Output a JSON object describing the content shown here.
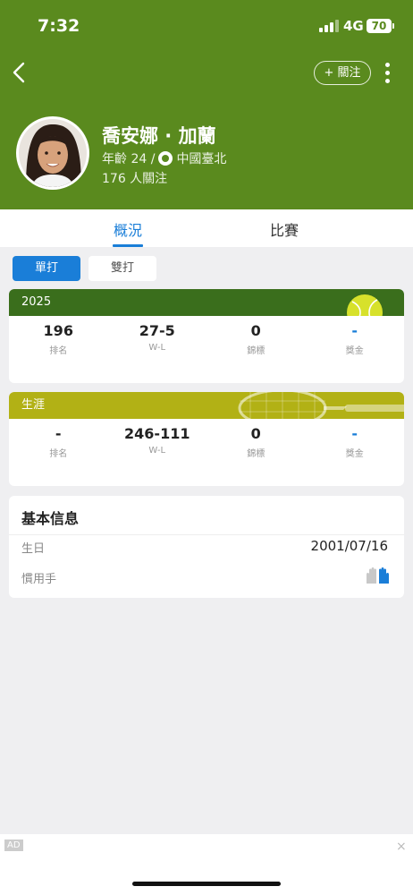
{
  "status_bar": {
    "time": "7:32",
    "network": "4G",
    "battery": "70"
  },
  "header": {
    "follow_label": "+ 關注",
    "player_name": "喬安娜 · 加蘭",
    "age": "年齡 24 /",
    "country": "中國臺北",
    "followers": "176 人關注",
    "background_color": "#5a8a1e"
  },
  "tabs": [
    {
      "label": "概況"
    },
    {
      "label": "比賽"
    }
  ],
  "filters": [
    {
      "label": "單打"
    },
    {
      "label": "雙打"
    }
  ],
  "season_card": {
    "title": "2025",
    "stats": [
      {
        "value": "196",
        "label": "排名"
      },
      {
        "value": "27-5",
        "label": "W-L"
      },
      {
        "value": "0",
        "label": "錦標"
      },
      {
        "value": "-",
        "label": "獎金"
      }
    ]
  },
  "career_card": {
    "title": "生涯",
    "stats": [
      {
        "value": "-",
        "label": "排名"
      },
      {
        "value": "246-111",
        "label": "W-L"
      },
      {
        "value": "0",
        "label": "錦標"
      },
      {
        "value": "-",
        "label": "獎金"
      }
    ]
  },
  "basic_info": {
    "title": "基本信息",
    "rows": [
      {
        "label": "生日",
        "value": "2001/07/16"
      },
      {
        "label": "慣用手",
        "value": ""
      }
    ]
  },
  "ad": {
    "badge": "AD",
    "close": "×"
  },
  "colors": {
    "accent": "#1a7ed8",
    "season_header": "#3a6e1c",
    "career_header": "#b2b115"
  },
  "icons": [
    "back-arrow-icon",
    "more-vertical-icon",
    "flag-icon",
    "tennis-ball-icon",
    "racket-icon",
    "hands-icon",
    "close-icon"
  ]
}
